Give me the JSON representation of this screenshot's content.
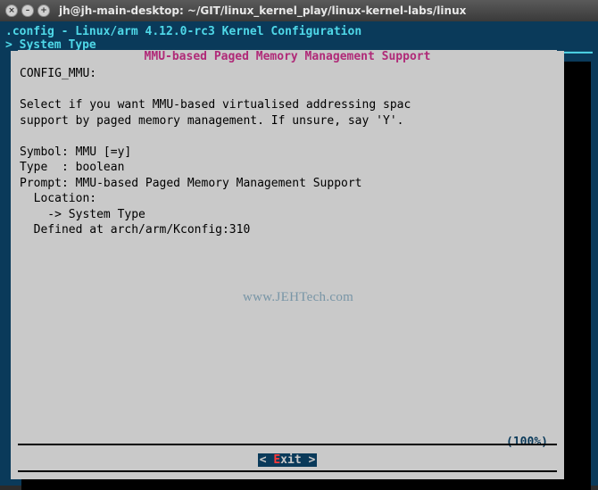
{
  "window": {
    "title": "jh@jh-main-desktop: ~/GIT/linux_kernel_play/linux-kernel-labs/linux"
  },
  "header": {
    "config_line": ".config - Linux/arm 4.12.0-rc3 Kernel Configuration",
    "breadcrumb": "> System Type "
  },
  "panel": {
    "title": "MMU-based Paged Memory Management Support",
    "body_lines": [
      "CONFIG_MMU:",
      "",
      "Select if you want MMU-based virtualised addressing spac",
      "support by paged memory management. If unsure, say 'Y'.",
      "",
      "Symbol: MMU [=y]",
      "Type  : boolean",
      "Prompt: MMU-based Paged Memory Management Support",
      "  Location:",
      "    -> System Type",
      "  Defined at arch/arm/Kconfig:310"
    ],
    "progress": "(100%)"
  },
  "buttons": {
    "exit_prefix": "< ",
    "exit_hotkey": "E",
    "exit_rest": "xit >"
  },
  "watermark": "www.JEHTech.com",
  "colors": {
    "terminal_bg": "#0a3a5a",
    "panel_bg": "#c9c9c9",
    "accent_cyan": "#4fd8e8",
    "magenta": "#b02a78",
    "hotkey_red": "#ff3a3a"
  }
}
